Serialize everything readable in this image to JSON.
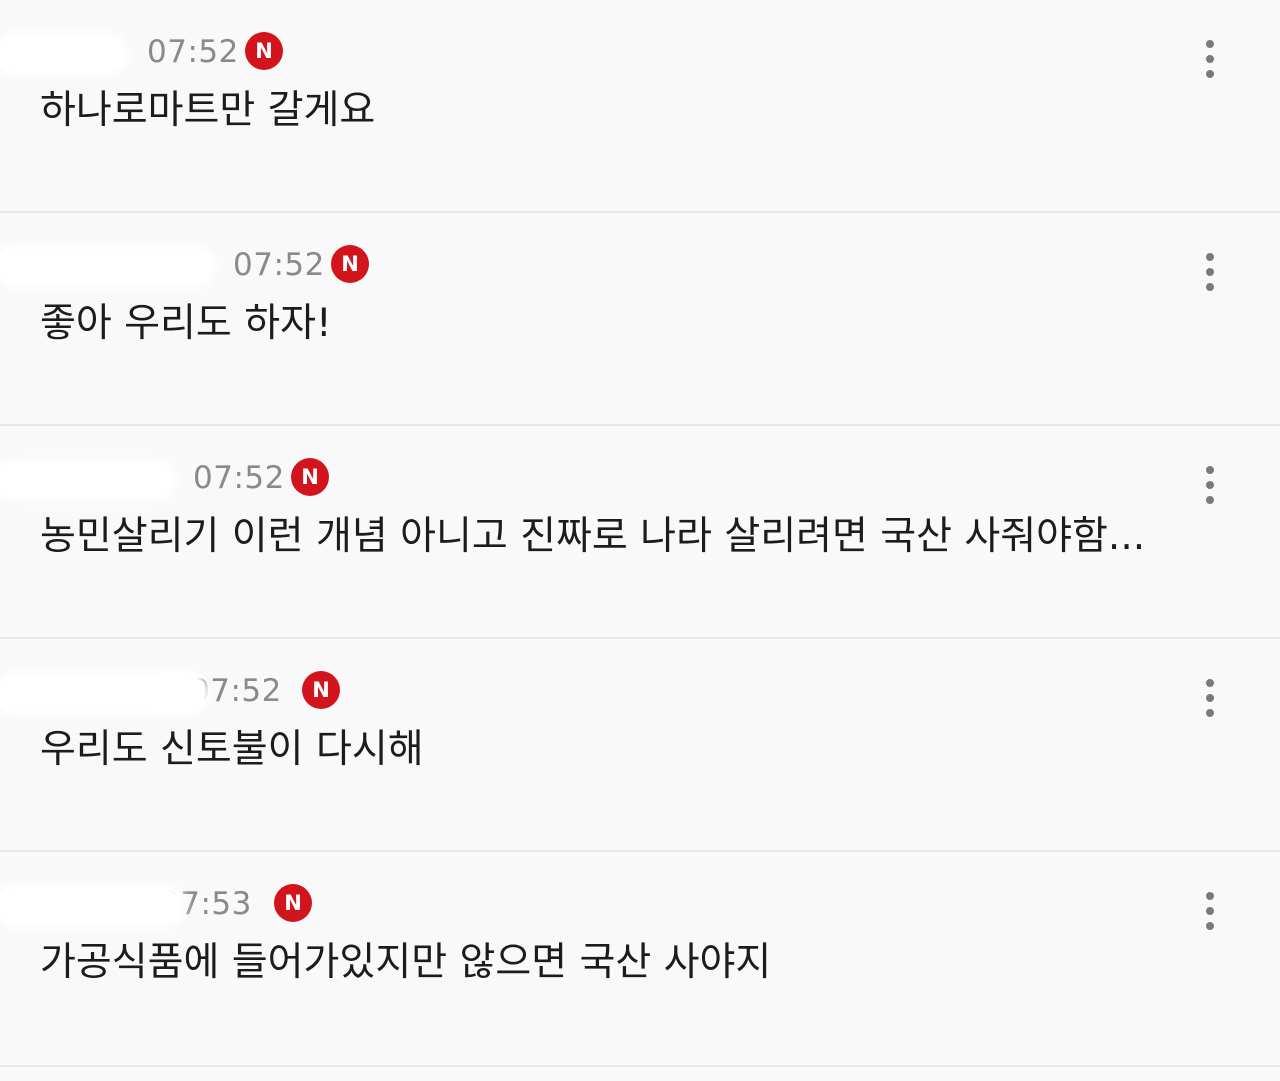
{
  "comments": [
    {
      "time": "07:52",
      "badge": "N",
      "text": "하나로마트만 갈게요"
    },
    {
      "time": "07:52",
      "badge": "N",
      "text": "좋아 우리도 하자!"
    },
    {
      "time": "07:52",
      "badge": "N",
      "text": "농민살리기 이런 개념 아니고 진짜로 나라 살리려면 국산 사줘야함..."
    },
    {
      "time": "07:52",
      "badge": "N",
      "text": "우리도 신토불이 다시해"
    },
    {
      "time": "07:53",
      "badge": "N",
      "text": "가공식품에 들어가있지만 않으면 국산 사야지"
    }
  ],
  "colors": {
    "background": "#f9f9f9",
    "divider": "#e6e6e6",
    "badge": "#d2141c",
    "time": "#8a8a8a",
    "text": "#1c1c1c"
  },
  "icons": {
    "badge": "new-badge-icon",
    "more": "more-vertical-icon"
  }
}
